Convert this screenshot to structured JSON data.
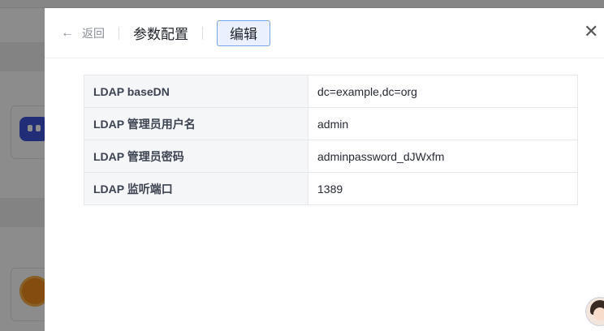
{
  "header": {
    "back_label": "返回",
    "title": "参数配置",
    "edit_label": "编辑",
    "close_glyph": "✕",
    "back_glyph": "←"
  },
  "config": {
    "rows": [
      {
        "key": "LDAP baseDN",
        "value": "dc=example,dc=org"
      },
      {
        "key": "LDAP 管理员用户名",
        "value": "admin"
      },
      {
        "key": "LDAP 管理员密码",
        "value": "adminpassword_dJWxfm"
      },
      {
        "key": "LDAP 监听端口",
        "value": "1389"
      }
    ]
  },
  "colors": {
    "edit_border": "#7aa6e6",
    "edit_bg": "#e8f1fd",
    "key_cell_bg": "#f5f6f8"
  },
  "icons": {
    "back": "arrow-left-icon",
    "close": "close-icon",
    "assistant": "assistant-avatar-icon"
  }
}
